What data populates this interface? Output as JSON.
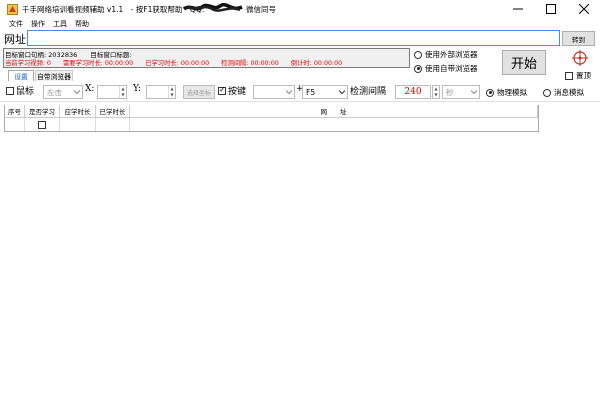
{
  "window": {
    "title": "千手网络培训看视频辅助 v1.1　- 按F1获取帮助　QQ:",
    "title_suffix": "微信同号",
    "icons": [
      "app-icon",
      "minimize-icon",
      "maximize-icon",
      "close-icon"
    ]
  },
  "menu": {
    "items": [
      {
        "label": "文件"
      },
      {
        "label": "操作"
      },
      {
        "label": "工具"
      },
      {
        "label": "帮助"
      }
    ]
  },
  "url_bar": {
    "label": "网址",
    "value": "",
    "goto_label": "转到"
  },
  "info": {
    "handle_label": "目标窗口句柄:",
    "handle_value": "2032836",
    "window_title_label": "目标窗口标题:",
    "window_title_value": "",
    "status": {
      "current_video_label": "当前学习视频:",
      "current_video_value": "0",
      "required_label": "需要学习时长:",
      "required_value": "00:00:00",
      "learned_label": "已学习时长:",
      "learned_value": "00:00:00",
      "interval_label": "检测间隔:",
      "interval_value": "00:00:00",
      "countdown_label": "倒计时:",
      "countdown_value": "00:00:00"
    }
  },
  "browser_options": {
    "external_label": "使用外部浏览器",
    "builtin_label": "使用自带浏览器",
    "selected": "builtin"
  },
  "start_button": {
    "label": "开始"
  },
  "topmost": {
    "label": "置顶",
    "checked": false
  },
  "tabs": [
    {
      "label": "设置",
      "active": true
    },
    {
      "label": "自带浏览器",
      "active": false
    }
  ],
  "controls": {
    "mouse_label": "鼠标",
    "mouse_checked": false,
    "mouse_button_value": "左击",
    "x_label": "X:",
    "x_value": "",
    "y_label": "Y:",
    "y_value": "",
    "select_coord_label": "选择坐标",
    "key_label": "按键",
    "key_checked": true,
    "key_modifier_value": "",
    "plus_label": "+",
    "key_value": "F5",
    "interval_label": "检测间隔",
    "interval_value": "240",
    "unit_value": "秒",
    "physical_label": "物理模拟",
    "message_label": "消息模拟",
    "simulation_selected": "physical"
  },
  "table": {
    "columns": [
      "序号",
      "是否学习",
      "应学时长",
      "已学时长",
      "网　　址"
    ],
    "rows": [
      {
        "index": "",
        "learn": false,
        "required": "",
        "learned": "",
        "url": ""
      }
    ]
  }
}
